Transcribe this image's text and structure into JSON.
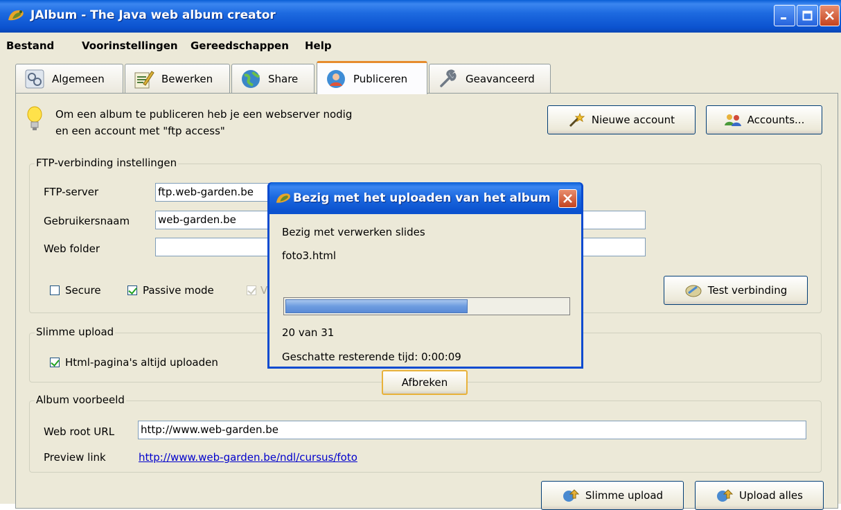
{
  "window": {
    "title": "JAlbum - The Java web album creator"
  },
  "menu": [
    "Bestand",
    "Voorinstellingen",
    "Gereedschappen",
    "Help"
  ],
  "tabs": [
    "Algemeen",
    "Bewerken",
    "Share",
    "Publiceren",
    "Geavanceerd"
  ],
  "active_tab": "Publiceren",
  "info": {
    "line1": "Om een album te publiceren heb je een webserver nodig",
    "line2": "en een account met \"ftp access\""
  },
  "buttons": {
    "new_account": "Nieuwe account",
    "accounts": "Accounts...",
    "test_connection": "Test verbinding",
    "smart_upload": "Slimme upload",
    "upload_all": "Upload alles"
  },
  "ftp": {
    "group_title": "FTP-verbinding instellingen",
    "server_label": "FTP-server",
    "server_value": "ftp.web-garden.be",
    "user_label": "Gebruikersnaam",
    "user_value": "web-garden.be",
    "folder_label": "Web folder",
    "folder_value": "",
    "secure_label": "Secure",
    "secure_checked": false,
    "passive_label": "Passive mode",
    "passive_checked": true,
    "third_label_partial": "V"
  },
  "smart": {
    "group_title": "Slimme upload",
    "always_html_label": "Html-pagina's altijd uploaden",
    "always_html_checked": true
  },
  "preview": {
    "group_title": "Album voorbeeld",
    "root_label": "Web root URL",
    "root_value": "http://www.web-garden.be",
    "link_label": "Preview link",
    "link_value": "http://www.web-garden.be/ndl/cursus/foto"
  },
  "dialog": {
    "title": "Bezig met het uploaden van het album",
    "status": "Bezig met verwerken slides",
    "file": "foto3.html",
    "progress_fraction": 0.645,
    "count": "20 van 31",
    "remaining": "Geschatte resterende tijd: 0:00:09",
    "cancel": "Afbreken"
  },
  "colors": {
    "titlebar": "#0b52cf",
    "progress": "#6d9ce0",
    "link": "#0000cc"
  }
}
